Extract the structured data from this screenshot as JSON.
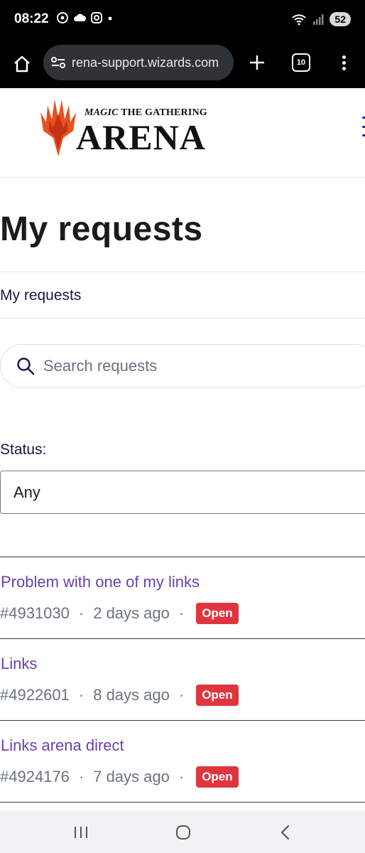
{
  "status_bar": {
    "time": "08:22",
    "battery": "52",
    "icons_left": [
      "chrome-icon",
      "cloud-icon",
      "instagram-icon",
      "dot-icon"
    ],
    "icons_right": [
      "wifi-icon",
      "signal-icon"
    ]
  },
  "browser": {
    "url": "rena-support.wizards.com",
    "tab_count": "10"
  },
  "header": {
    "logo_tagline_magic": "MAGIC",
    "logo_tagline_rest": "THE GATHERING",
    "logo_word": "ARENA"
  },
  "main": {
    "title": "My requests",
    "breadcrumb": "My requests",
    "search": {
      "placeholder": "Search requests"
    },
    "status_filter": {
      "label": "Status:",
      "selected": "Any"
    },
    "requests": [
      {
        "title": "Problem with one of my links",
        "id": "#4931030",
        "age": "2 days ago",
        "status": "Open"
      },
      {
        "title": "Links",
        "id": "#4922601",
        "age": "8 days ago",
        "status": "Open"
      },
      {
        "title": "Links arena direct",
        "id": "#4924176",
        "age": "7 days ago",
        "status": "Open"
      }
    ],
    "meta_separator": "·"
  },
  "colors": {
    "link": "#6b3fb0",
    "badge_open": "#e0353f",
    "meta": "#6b7280",
    "logo_flame": "#e8501e"
  }
}
